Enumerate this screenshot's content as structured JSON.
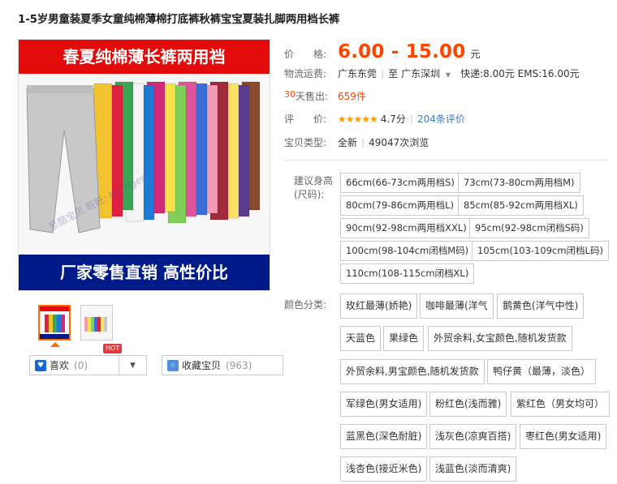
{
  "product": {
    "title": "1-5岁男童装夏季女童纯棉薄棉打底裤秋裤宝宝夏装扎脚两用档长裤",
    "image": {
      "banner_top": "春夏纯棉薄长裤两用裆",
      "banner_bottom": "厂家零售直销 高性价比",
      "watermark": "至酷宝贝 旺旺: bo_tiger"
    }
  },
  "actions": {
    "like_label": "喜欢",
    "like_count": "(0)",
    "hot_badge": "HOT",
    "fav_label": "收藏宝贝",
    "fav_count": "(963)"
  },
  "info": {
    "price_label": "价　　格:",
    "price_value": "6.00 - 15.00",
    "price_unit": "元",
    "shipping_label": "物流运费:",
    "ship_from": "广东东莞",
    "ship_to_prefix": "至",
    "ship_to": "广东深圳",
    "ship_methods": "快递:8.00元 EMS:16.00元",
    "sales_label_num": "30",
    "sales_label": "天售出:",
    "sales_value": "659件",
    "rating_label": "评　　价:",
    "rating_stars": "★★★★★",
    "rating_score": "4.7分",
    "review_link": "204条评价",
    "type_label": "宝贝类型:",
    "type_value": "全新",
    "views": "49047次浏览"
  },
  "sizes": {
    "label": "建议身高(尺码):",
    "options": [
      "66cm(66-73cm两用档S)",
      "73cm(73-80cm两用档M)",
      "80cm(79-86cm两用档L)",
      "85cm(85-92cm两用档XL)",
      "90cm(92-98cm两用档XXL)",
      "95cm(92-98cm闭档S码)",
      "100cm(98-104cm闭档M码)",
      "105cm(103-109cm闭档L码)",
      "110cm(108-115cm闭档XL)"
    ]
  },
  "colors": {
    "label": "颜色分类:",
    "options": [
      "玫红最薄(娇艳)",
      "咖啡最薄(洋气",
      "鹅黄色(洋气中性)",
      "天蓝色",
      "果绿色",
      "外贸余料,女宝颜色,随机发货款",
      "外贸余料,男宝颜色,随机发货款",
      "鸭仔黄（最薄，淡色）",
      "军绿色(男女适用)",
      "粉红色(浅而雅)",
      "紫红色（男女均可）",
      "蓝黑色(深色耐脏)",
      "浅灰色(凉爽百搭)",
      "枣红色(男女适用)",
      "浅杏色(接近米色)",
      "浅蓝色(淡而清爽)"
    ]
  },
  "pant_colors": [
    "#c8c8c8",
    "#f2c230",
    "#e02040",
    "#3aa655",
    "#f3f3f3",
    "#1d7bd8",
    "#d22a7a",
    "#f7e24b",
    "#7fcf5a",
    "#e0529a",
    "#3b6dd6",
    "#f39ab8",
    "#a02b3a",
    "#ffe066",
    "#5a3d8c",
    "#8b4b2a"
  ]
}
